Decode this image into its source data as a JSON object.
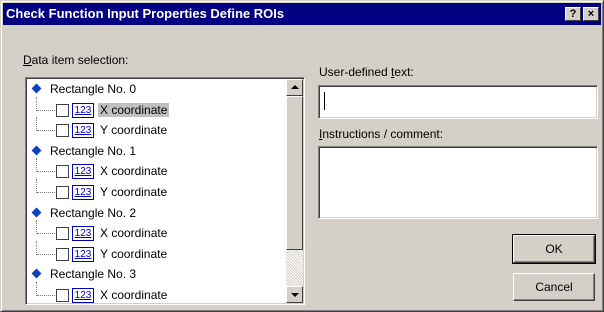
{
  "window": {
    "title": "Check Function Input Properties Define ROIs",
    "help_glyph": "?",
    "close_glyph": "×"
  },
  "data_item_selection": {
    "label_accel": "D",
    "label_rest": "ata item selection:",
    "tree": [
      {
        "type": "parent",
        "label": "Rectangle No. 0"
      },
      {
        "type": "child",
        "badge": "123",
        "label": "X coordinate",
        "selected": true
      },
      {
        "type": "child",
        "badge": "123",
        "label": "Y coordinate"
      },
      {
        "type": "parent",
        "label": "Rectangle No. 1"
      },
      {
        "type": "child",
        "badge": "123",
        "label": "X coordinate"
      },
      {
        "type": "child",
        "badge": "123",
        "label": "Y coordinate"
      },
      {
        "type": "parent",
        "label": "Rectangle No. 2"
      },
      {
        "type": "child",
        "badge": "123",
        "label": "X coordinate"
      },
      {
        "type": "child",
        "badge": "123",
        "label": "Y coordinate"
      },
      {
        "type": "parent",
        "label": "Rectangle No. 3"
      },
      {
        "type": "child",
        "badge": "123",
        "label": "X coordinate"
      }
    ]
  },
  "user_defined_text": {
    "label_before": "User-defined ",
    "label_accel": "t",
    "label_after": "ext:",
    "value": ""
  },
  "instructions": {
    "label_accel": "I",
    "label_rest": "nstructions / comment:",
    "value": ""
  },
  "buttons": {
    "ok": "OK",
    "cancel": "Cancel"
  },
  "icons": {
    "tree_parent": "blue-diamond-icon",
    "tree_child_checkbox": "checkbox-icon",
    "tree_child_badge": "numeric-123-icon",
    "scroll_up": "arrow-up-icon",
    "scroll_down": "arrow-down-icon"
  },
  "colors": {
    "titlebar": "#000080",
    "face": "#d4d0c8",
    "badge": "#0000c0",
    "diamond": "#1040c0"
  }
}
